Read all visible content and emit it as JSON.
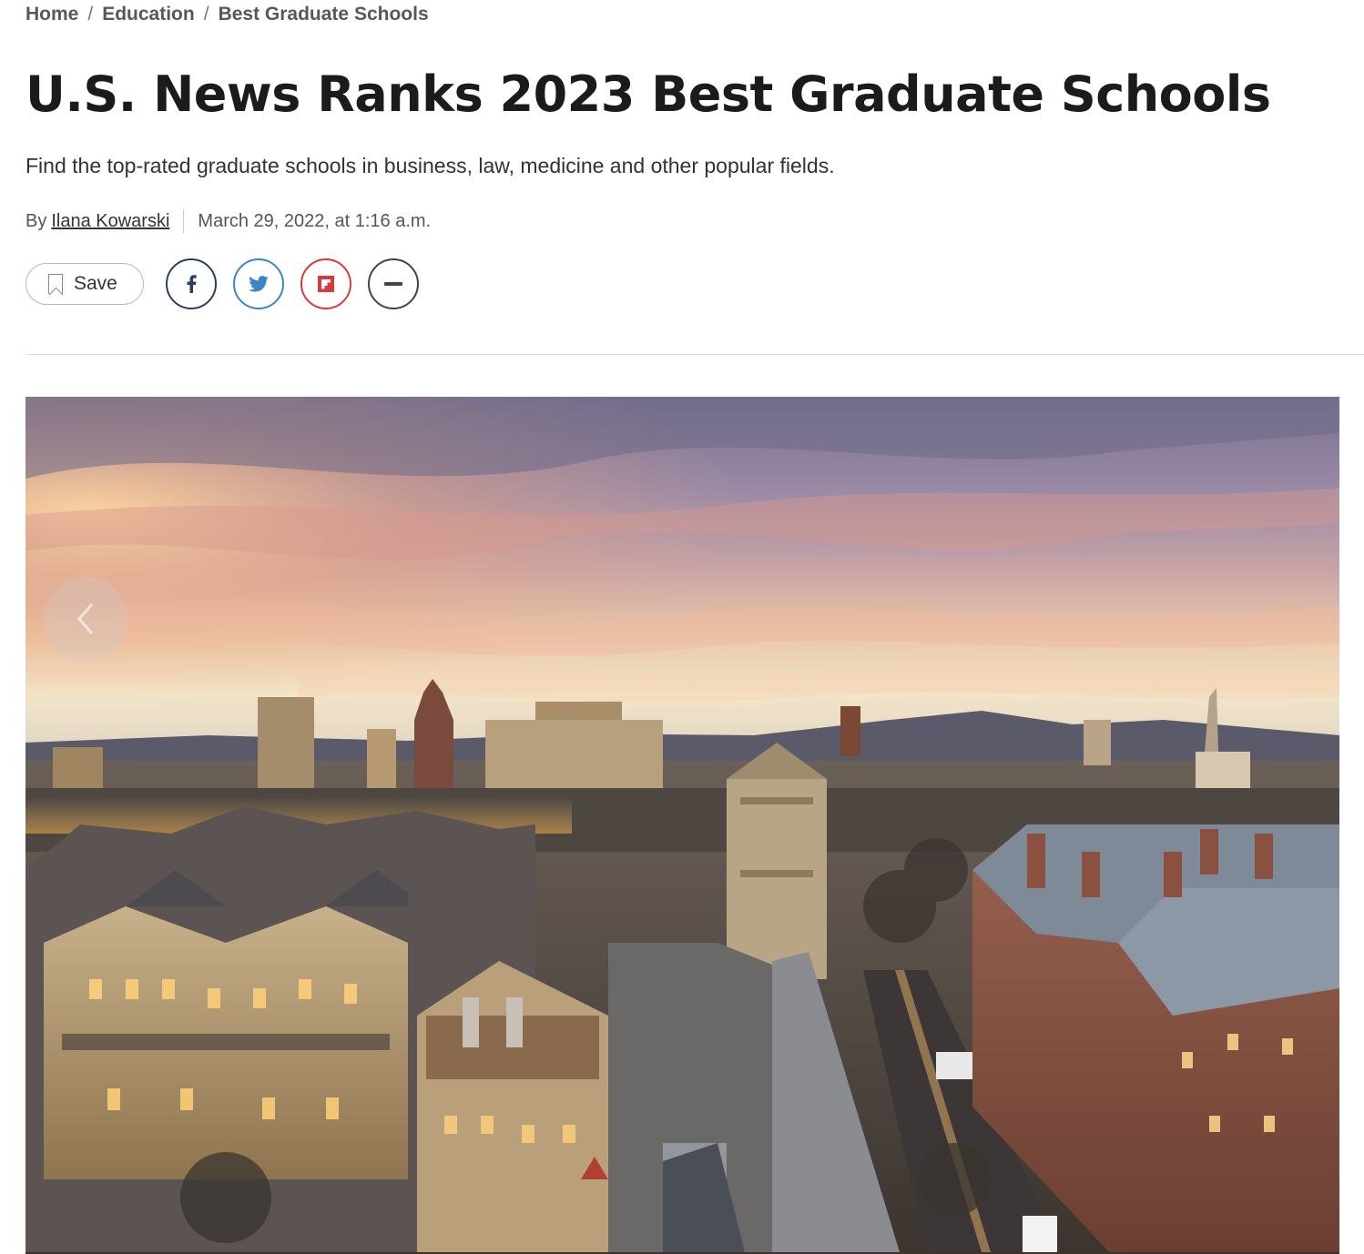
{
  "breadcrumb": {
    "items": [
      "Home",
      "Education",
      "Best Graduate Schools"
    ],
    "separator": "/"
  },
  "article": {
    "title": "U.S. News Ranks 2023 Best Graduate Schools",
    "subtitle": "Find the top-rated graduate schools in business, law, medicine and other popular fields.",
    "by_label": "By",
    "author": "Ilana Kowarski",
    "date": "March 29, 2022, at 1:16 a.m."
  },
  "actions": {
    "save_label": "Save",
    "share_icons": [
      "facebook-icon",
      "twitter-icon",
      "flipboard-icon",
      "more-icon"
    ]
  },
  "colors": {
    "facebook": "#2d3e63",
    "twitter": "#3b86c9",
    "flipboard": "#d63a3a",
    "more": "#444444"
  },
  "hero": {
    "image_subject": "aerial view of a gothic-style university campus at sunset",
    "prev_icon": "chevron-left-icon"
  }
}
